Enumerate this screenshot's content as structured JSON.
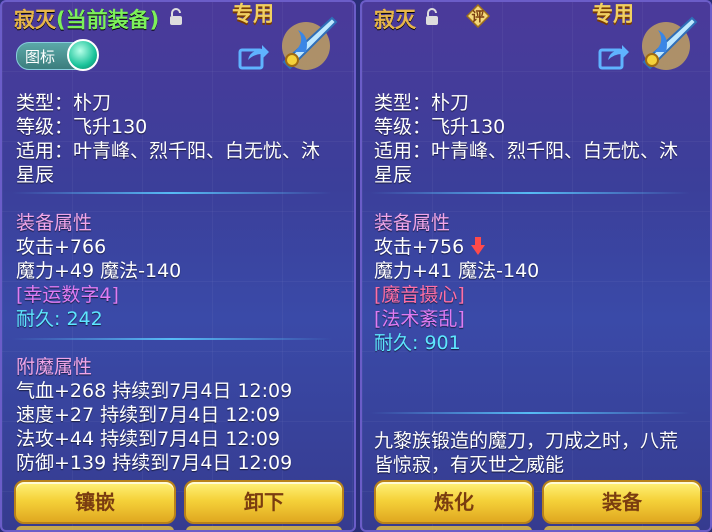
{
  "left": {
    "name": "寂灭",
    "equipped_tag": "(当前装备)",
    "special": "专用",
    "icon_toggle_label": "图标",
    "type": "类型：朴刀",
    "level": "等级：飞升130",
    "usable_line1": "适用：叶青峰、烈千阳、白无忧、沐",
    "usable_line2": "星辰",
    "section_attr": "装备属性",
    "attack": "攻击+766",
    "magic": "魔力+49 魔法-140",
    "special_attr": "[幸运数字4]",
    "durability_label": "耐久:",
    "durability_value": "242",
    "section_enchant": "附魔属性",
    "enchants": [
      "气血+268 持续到7月4日 12:09",
      "速度+27 持续到7月4日 12:09",
      "法攻+44 持续到7月4日 12:09",
      "防御+139 持续到7月4日 12:09"
    ],
    "btn_inlay": "镶嵌",
    "btn_unequip": "卸下"
  },
  "right": {
    "name": "寂灭",
    "rate_label": "评",
    "special": "专用",
    "type": "类型：朴刀",
    "level": "等级：飞升130",
    "usable_line1": "适用：叶青峰、烈千阳、白无忧、沐",
    "usable_line2": "星辰",
    "section_attr": "装备属性",
    "attack": "攻击+756",
    "magic": "魔力+41 魔法-140",
    "special_attr1": "[魔音摄心]",
    "special_attr2": "[法术紊乱]",
    "durability_label": "耐久:",
    "durability_value": "901",
    "desc_line1": "九黎族锻造的魔刀，刀成之时，八荒",
    "desc_line2": "皆惊寂，有灭世之威能",
    "btn_refine": "炼化",
    "btn_equip": "装备"
  },
  "colors": {
    "title_gold": "#e6b54a",
    "equipped_green": "#7cf05a",
    "section_pink": "#f0a6e8",
    "durability_cyan": "#5ee6ff",
    "button_yellow": "#f5d23a"
  },
  "icons": {
    "lock": "lock-icon",
    "share": "share-icon",
    "down_arrow": "down-arrow-icon",
    "rate": "rate-badge-icon",
    "weapon": "blade-item-icon"
  }
}
